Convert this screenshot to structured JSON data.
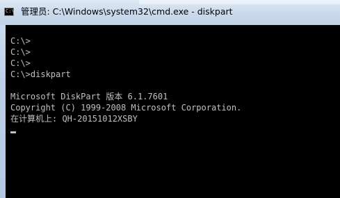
{
  "window": {
    "title": "管理员: C:\\Windows\\system32\\cmd.exe - diskpart",
    "icon": "cmd-icon",
    "icon_glyph": "C:\\"
  },
  "console": {
    "lines": [
      "C:\\>",
      "C:\\>",
      "C:\\>",
      "C:\\>diskpart",
      "",
      "Microsoft DiskPart 版本 6.1.7601",
      "Copyright (C) 1999-2008 Microsoft Corporation.",
      "在计算机上: QH-20151012XSBY"
    ],
    "text_color": "#c0c0c0",
    "background_color": "#000000"
  }
}
